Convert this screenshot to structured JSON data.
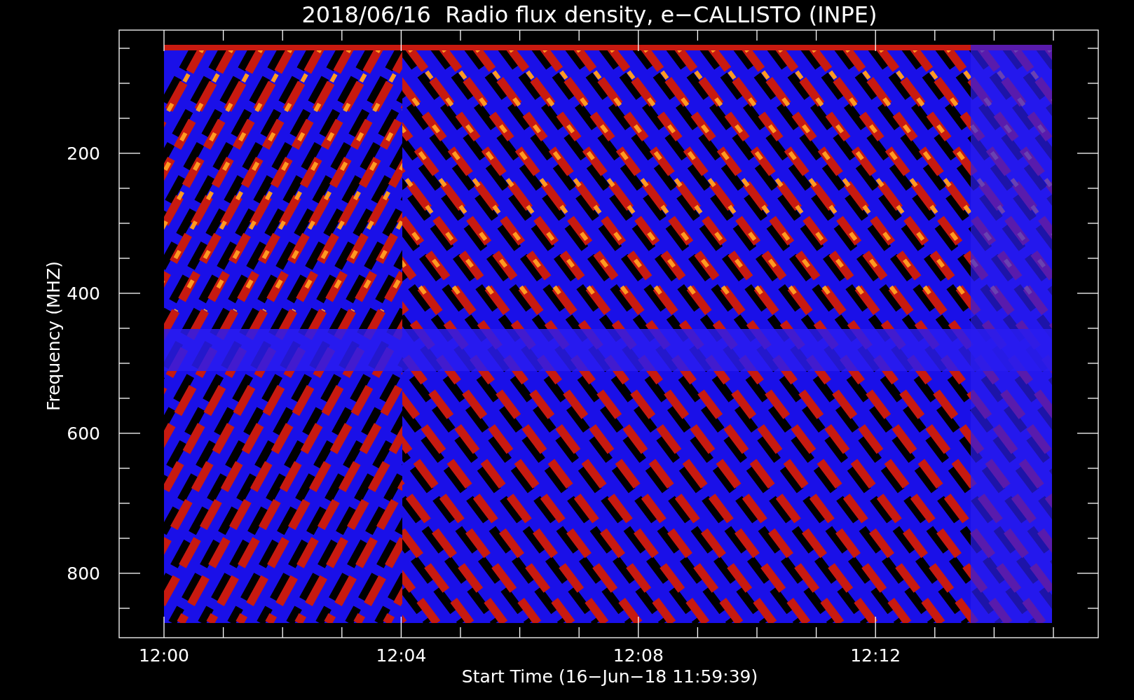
{
  "title": "2018/06/16  Radio flux density, e−CALLISTO (INPE)",
  "y_axis": {
    "label": "Frequency (MHZ)",
    "ticks": [
      "200",
      "400",
      "600",
      "800"
    ]
  },
  "x_axis": {
    "label": "Start Time (16−Jun−18 11:59:39)",
    "ticks": [
      "12:00",
      "12:04",
      "12:08",
      "12:12"
    ]
  }
}
